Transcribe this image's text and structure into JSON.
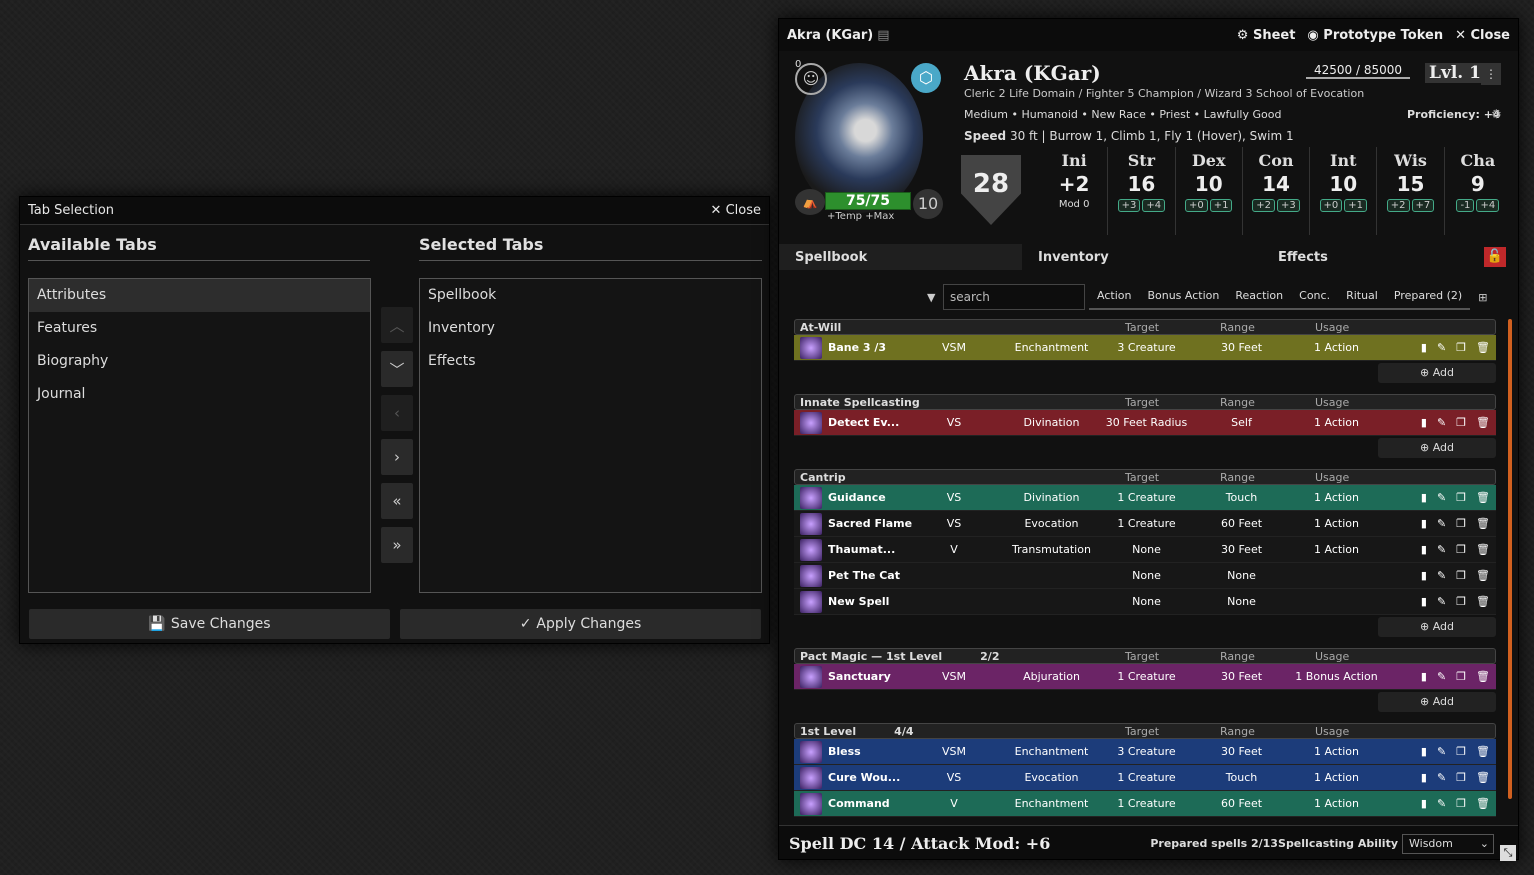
{
  "tab_window": {
    "title": "Tab Selection",
    "close": "✕ Close",
    "available_title": "Available Tabs",
    "selected_title": "Selected Tabs",
    "available": [
      "Attributes",
      "Features",
      "Biography",
      "Journal"
    ],
    "selected": [
      "Spellbook",
      "Inventory",
      "Effects"
    ],
    "save": "Save Changes",
    "apply": "Apply Changes"
  },
  "sheet": {
    "window_title": "Akra (KGar)",
    "hdr_sheet": "Sheet",
    "hdr_token": "Prototype Token",
    "hdr_close": "✕ Close",
    "name": "Akra (KGar)",
    "classes": "Cleric 2 Life Domain / Fighter 5 Champion / Wizard 3 School of Evocation",
    "details": "Medium • Humanoid • New Race • Priest • Lawfully Good",
    "proficiency": "Proficiency: +4",
    "speed_label": "Speed",
    "speed": "30 ft | Burrow 1, Climb 1, Fly 1 (Hover), Swim 1",
    "xp": "42500 / 85000",
    "level": "Lvl. 10",
    "hp": "75/75",
    "hp_extra": "+Temp +Max",
    "hit_dice": "10",
    "ac": "28",
    "inspiration": "0",
    "ini": {
      "name": "Ini",
      "val": "+2",
      "mod": "Mod  0"
    },
    "abilities": [
      {
        "name": "Str",
        "val": "16",
        "m1": "+3",
        "m2": "+4"
      },
      {
        "name": "Dex",
        "val": "10",
        "m1": "+0",
        "m2": "+1"
      },
      {
        "name": "Con",
        "val": "14",
        "m1": "+2",
        "m2": "+3"
      },
      {
        "name": "Int",
        "val": "10",
        "m1": "+0",
        "m2": "+1"
      },
      {
        "name": "Wis",
        "val": "15",
        "m1": "+2",
        "m2": "+7"
      },
      {
        "name": "Cha",
        "val": "9",
        "m1": "-1",
        "m2": "+4"
      }
    ],
    "tabs": [
      "Spellbook",
      "Inventory",
      "Effects"
    ],
    "search_placeholder": "search",
    "filters": [
      "Action",
      "Bonus Action",
      "Reaction",
      "Conc.",
      "Ritual",
      "Prepared (2)"
    ],
    "col_target": "Target",
    "col_range": "Range",
    "col_usage": "Usage",
    "add": "Add",
    "sections": [
      {
        "title": "At-Will",
        "extra": "",
        "spells": [
          {
            "name": "Bane   3 /3",
            "comp": "VSM",
            "school": "Enchantment",
            "target": "3 Creature",
            "range": "30 Feet",
            "usage": "1 Action",
            "color": "#6f7120"
          }
        ]
      },
      {
        "title": "Innate Spellcasting",
        "extra": "",
        "spells": [
          {
            "name": "Detect Ev...",
            "comp": "VS",
            "school": "Divination",
            "target": "30 Feet Radius",
            "range": "Self",
            "usage": "1 Action",
            "color": "#7a1f27"
          }
        ]
      },
      {
        "title": "Cantrip",
        "extra": "",
        "spells": [
          {
            "name": "Guidance",
            "comp": "VS",
            "school": "Divination",
            "target": "1 Creature",
            "range": "Touch",
            "usage": "1 Action",
            "color": "#1d6b57"
          },
          {
            "name": "Sacred Flame",
            "comp": "VS",
            "school": "Evocation",
            "target": "1 Creature",
            "range": "60 Feet",
            "usage": "1 Action",
            "color": ""
          },
          {
            "name": "Thaumat...",
            "comp": "V",
            "school": "Transmutation",
            "target": "None",
            "range": "30 Feet",
            "usage": "1 Action",
            "color": ""
          },
          {
            "name": "Pet The Cat",
            "comp": "",
            "school": "",
            "target": "None",
            "range": "None",
            "usage": "",
            "color": ""
          },
          {
            "name": "New Spell",
            "comp": "",
            "school": "",
            "target": "None",
            "range": "None",
            "usage": "",
            "color": ""
          }
        ]
      },
      {
        "title": "Pact Magic — 1st Level",
        "extra": "2/2",
        "spells": [
          {
            "name": "Sanctuary",
            "comp": "VSM",
            "school": "Abjuration",
            "target": "1 Creature",
            "range": "30 Feet",
            "usage": "1 Bonus Action",
            "color": "#6b2466"
          }
        ]
      },
      {
        "title": "1st Level",
        "extra": "4/4",
        "spells": [
          {
            "name": "Bless",
            "comp": "VSM",
            "school": "Enchantment",
            "target": "3 Creature",
            "range": "30 Feet",
            "usage": "1 Action",
            "color": "#1c3c7a"
          },
          {
            "name": "Cure Wou...",
            "comp": "VS",
            "school": "Evocation",
            "target": "1 Creature",
            "range": "Touch",
            "usage": "1 Action",
            "color": "#1c3c7a"
          },
          {
            "name": "Command",
            "comp": "V",
            "school": "Enchantment",
            "target": "1 Creature",
            "range": "60 Feet",
            "usage": "1 Action",
            "color": "#1d6b57"
          }
        ]
      }
    ],
    "footer_dc": "Spell DC 14 / Attack Mod: +6",
    "footer_prepared": "Prepared spells 2/13",
    "footer_ability_label": "Spellcasting Ability",
    "footer_ability": "Wisdom"
  }
}
